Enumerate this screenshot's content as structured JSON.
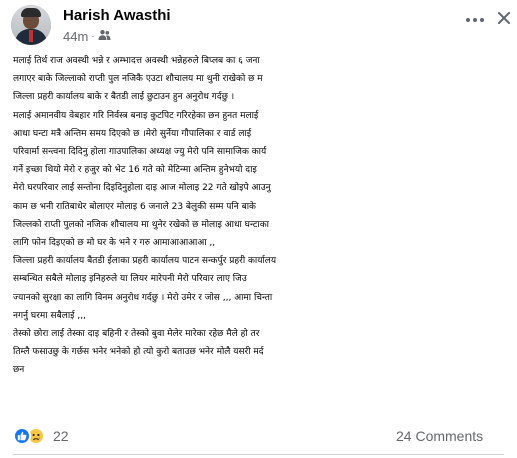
{
  "post": {
    "author": "Harish Awasthi",
    "time": "44m",
    "separator": "·",
    "privacy_icon": "friends-icon",
    "body_lines": [
      "मलाई तिर्थ राज अवस्थी भन्ने र अम्भादत्त अवस्थी  भन्नेहरुले बिप्लब का ६ जना",
      "लगाएर बाके जिल्लाको राप्ती पुल नजिकै एउटा शौचालय मा थुनी राखेको छ म",
      "जिल्ला प्रहरी कार्यालय बाके र बैतडी लाई छुटाउन हुन अनुरोध गर्दछु ।",
      "मलाई अमानवीय वेबहार गरि निर्वस्त्र बनाइ कुटपिट गरिरहेका छन हुनत मलाई",
      "आधा घन्टा मत्रै अन्तिम समय दिएको छ ।मेरो सुर्नेया गौपालिका र वार्ड लाई",
      "परिवार्मा सन्त्वना दिदिनु होला गाउपालिका अध्यक्ष ज्यु मेरो पनि सामाजिक कार्य",
      "गर्ने इच्छा थियो मेरो र हजुर को भेट 16 गते को मेटिन्मा अन्तिम हुनेभयो दाइ",
      "मेरो घरपरिवार लाई सन्तोना दिइदिनुहोला दाइ आज मोलाइ 22 गते खोइपे आउनु",
      "काम छ भनी रातिबाधेर  बोलाएर मोलाइ 6 जनाले 23 बेलुकी सम्म पनि बाके",
      "जिल्लको राप्ती पुलको नजिक शौचालय मा थुनेर रखेको छ मोलाइ आधा घन्टाका",
      "लागि फोन दिइएको छ मो घर के भने र गरु आमाआआआआ ,,",
      "जिल्ला प्रहरी कार्यालय बैतडी ईलाका प्रहरी कार्यालय पाटन सन्कर्पुर प्रहरी कार्यालय",
      "सम्बन्धित सबैले मोलाइ इनिहरुले या लियर मारेपनी मेरो परिवार लाए जिउ",
      "ज्यानको सुरक्षा का लागि विनम अनुरोध गर्दछु । मेरो उमेर र जोस ,,, आमा चिन्ता",
      "नगर्नु घरमा सबैलाई ,,,",
      "तेस्को छोरा लाई तेस्का दाइ बहिनी र तेस्को बुवा मेलेर मारेका रहेछ मैले हो तर",
      "तिम्लै फसाउछु के गर्छस भनेर भनेको हो त्यो कुरो बताउछ भनेर मोलै यसरी मर्द",
      "छन"
    ]
  },
  "footer": {
    "reaction_icons": [
      "like-icon",
      "sad-icon"
    ],
    "reaction_count": "22",
    "comments_label": "24 Comments"
  },
  "colors": {
    "like": "#1877f2",
    "sad": "#f7c844",
    "secondary_text": "#65676b"
  }
}
